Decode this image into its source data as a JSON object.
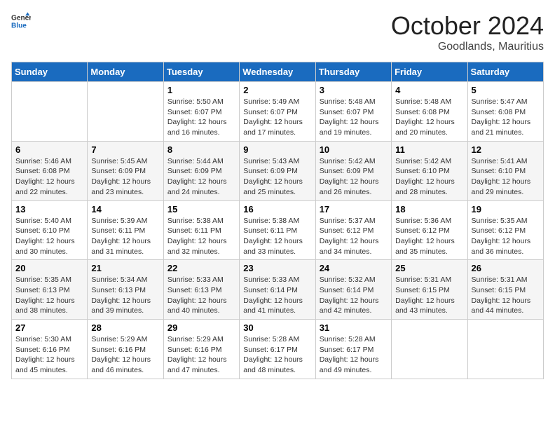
{
  "header": {
    "logo_line1": "General",
    "logo_line2": "Blue",
    "month": "October 2024",
    "location": "Goodlands, Mauritius"
  },
  "weekdays": [
    "Sunday",
    "Monday",
    "Tuesday",
    "Wednesday",
    "Thursday",
    "Friday",
    "Saturday"
  ],
  "weeks": [
    [
      {
        "day": null,
        "data": null
      },
      {
        "day": null,
        "data": null
      },
      {
        "day": "1",
        "data": "Sunrise: 5:50 AM\nSunset: 6:07 PM\nDaylight: 12 hours and 16 minutes."
      },
      {
        "day": "2",
        "data": "Sunrise: 5:49 AM\nSunset: 6:07 PM\nDaylight: 12 hours and 17 minutes."
      },
      {
        "day": "3",
        "data": "Sunrise: 5:48 AM\nSunset: 6:07 PM\nDaylight: 12 hours and 19 minutes."
      },
      {
        "day": "4",
        "data": "Sunrise: 5:48 AM\nSunset: 6:08 PM\nDaylight: 12 hours and 20 minutes."
      },
      {
        "day": "5",
        "data": "Sunrise: 5:47 AM\nSunset: 6:08 PM\nDaylight: 12 hours and 21 minutes."
      }
    ],
    [
      {
        "day": "6",
        "data": "Sunrise: 5:46 AM\nSunset: 6:08 PM\nDaylight: 12 hours and 22 minutes."
      },
      {
        "day": "7",
        "data": "Sunrise: 5:45 AM\nSunset: 6:09 PM\nDaylight: 12 hours and 23 minutes."
      },
      {
        "day": "8",
        "data": "Sunrise: 5:44 AM\nSunset: 6:09 PM\nDaylight: 12 hours and 24 minutes."
      },
      {
        "day": "9",
        "data": "Sunrise: 5:43 AM\nSunset: 6:09 PM\nDaylight: 12 hours and 25 minutes."
      },
      {
        "day": "10",
        "data": "Sunrise: 5:42 AM\nSunset: 6:09 PM\nDaylight: 12 hours and 26 minutes."
      },
      {
        "day": "11",
        "data": "Sunrise: 5:42 AM\nSunset: 6:10 PM\nDaylight: 12 hours and 28 minutes."
      },
      {
        "day": "12",
        "data": "Sunrise: 5:41 AM\nSunset: 6:10 PM\nDaylight: 12 hours and 29 minutes."
      }
    ],
    [
      {
        "day": "13",
        "data": "Sunrise: 5:40 AM\nSunset: 6:10 PM\nDaylight: 12 hours and 30 minutes."
      },
      {
        "day": "14",
        "data": "Sunrise: 5:39 AM\nSunset: 6:11 PM\nDaylight: 12 hours and 31 minutes."
      },
      {
        "day": "15",
        "data": "Sunrise: 5:38 AM\nSunset: 6:11 PM\nDaylight: 12 hours and 32 minutes."
      },
      {
        "day": "16",
        "data": "Sunrise: 5:38 AM\nSunset: 6:11 PM\nDaylight: 12 hours and 33 minutes."
      },
      {
        "day": "17",
        "data": "Sunrise: 5:37 AM\nSunset: 6:12 PM\nDaylight: 12 hours and 34 minutes."
      },
      {
        "day": "18",
        "data": "Sunrise: 5:36 AM\nSunset: 6:12 PM\nDaylight: 12 hours and 35 minutes."
      },
      {
        "day": "19",
        "data": "Sunrise: 5:35 AM\nSunset: 6:12 PM\nDaylight: 12 hours and 36 minutes."
      }
    ],
    [
      {
        "day": "20",
        "data": "Sunrise: 5:35 AM\nSunset: 6:13 PM\nDaylight: 12 hours and 38 minutes."
      },
      {
        "day": "21",
        "data": "Sunrise: 5:34 AM\nSunset: 6:13 PM\nDaylight: 12 hours and 39 minutes."
      },
      {
        "day": "22",
        "data": "Sunrise: 5:33 AM\nSunset: 6:13 PM\nDaylight: 12 hours and 40 minutes."
      },
      {
        "day": "23",
        "data": "Sunrise: 5:33 AM\nSunset: 6:14 PM\nDaylight: 12 hours and 41 minutes."
      },
      {
        "day": "24",
        "data": "Sunrise: 5:32 AM\nSunset: 6:14 PM\nDaylight: 12 hours and 42 minutes."
      },
      {
        "day": "25",
        "data": "Sunrise: 5:31 AM\nSunset: 6:15 PM\nDaylight: 12 hours and 43 minutes."
      },
      {
        "day": "26",
        "data": "Sunrise: 5:31 AM\nSunset: 6:15 PM\nDaylight: 12 hours and 44 minutes."
      }
    ],
    [
      {
        "day": "27",
        "data": "Sunrise: 5:30 AM\nSunset: 6:16 PM\nDaylight: 12 hours and 45 minutes."
      },
      {
        "day": "28",
        "data": "Sunrise: 5:29 AM\nSunset: 6:16 PM\nDaylight: 12 hours and 46 minutes."
      },
      {
        "day": "29",
        "data": "Sunrise: 5:29 AM\nSunset: 6:16 PM\nDaylight: 12 hours and 47 minutes."
      },
      {
        "day": "30",
        "data": "Sunrise: 5:28 AM\nSunset: 6:17 PM\nDaylight: 12 hours and 48 minutes."
      },
      {
        "day": "31",
        "data": "Sunrise: 5:28 AM\nSunset: 6:17 PM\nDaylight: 12 hours and 49 minutes."
      },
      {
        "day": null,
        "data": null
      },
      {
        "day": null,
        "data": null
      }
    ]
  ]
}
